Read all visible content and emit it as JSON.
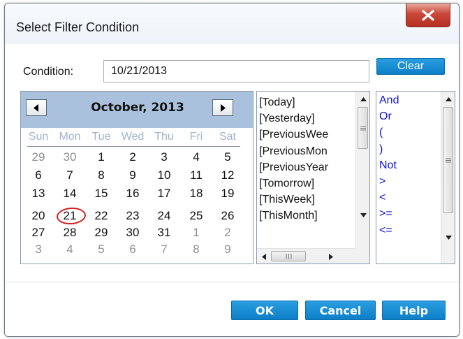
{
  "dialog": {
    "title": "Select Filter Condition"
  },
  "condition": {
    "label": "Condition:",
    "value": "10/21/2013"
  },
  "buttons": {
    "clear": "Clear",
    "ok": "OK",
    "cancel": "Cancel",
    "help": "Help"
  },
  "calendar": {
    "month_title": "October, 2013",
    "weekdays": [
      "Sun",
      "Mon",
      "Tue",
      "Wed",
      "Thu",
      "Fri",
      "Sat"
    ],
    "weeks": [
      [
        "29",
        "30",
        "1",
        "2",
        "3",
        "4",
        "5"
      ],
      [
        "6",
        "7",
        "8",
        "9",
        "10",
        "11",
        "12"
      ],
      [
        "13",
        "14",
        "15",
        "16",
        "17",
        "18",
        "19"
      ],
      [
        "20",
        "21",
        "22",
        "23",
        "24",
        "25",
        "26"
      ],
      [
        "27",
        "28",
        "29",
        "30",
        "31",
        "1",
        "2"
      ],
      [
        "3",
        "4",
        "5",
        "6",
        "7",
        "8",
        "9"
      ]
    ],
    "selected_day": "21"
  },
  "date_keywords": [
    "[Today]",
    "[Yesterday]",
    "[PreviousWee",
    "[PreviousMon",
    "[PreviousYear",
    "[Tomorrow]",
    "[ThisWeek]",
    "[ThisMonth]"
  ],
  "operators": [
    "And",
    "Or",
    "(",
    ")",
    "Not",
    ">",
    "<",
    ">=",
    "<="
  ],
  "colors": {
    "accent": "#0c7fc8",
    "close": "#c9483a",
    "operator_text": "#1010d8",
    "header": "#a9c1dc"
  },
  "icons": {
    "close": "close-x-icon",
    "prev": "triangle-left-icon",
    "next": "triangle-right-icon",
    "scroll_up": "arrow-up-icon",
    "scroll_down": "arrow-down-icon",
    "scroll_left": "arrow-left-icon",
    "scroll_right": "arrow-right-icon",
    "grip": "grip-icon"
  }
}
